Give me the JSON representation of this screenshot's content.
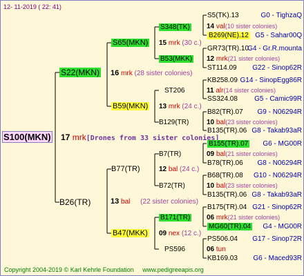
{
  "header": {
    "date": "12- 11-2019 ( 22: 41)"
  },
  "root": {
    "name": "S100(MKN)",
    "gen": "17",
    "unit": "mrk",
    "note": "[Drones from 33 sister colonies]"
  },
  "sire": {
    "name": "S22(MKN)",
    "gen": "16",
    "unit": "mrk",
    "note": "(28 sister colonies)"
  },
  "dam": {
    "name": "B26(TR)",
    "gen": "13",
    "unit": "bal",
    "note": "(22 sister colonies)"
  },
  "s_s": {
    "name": "S65(MKN)",
    "gen": "15",
    "unit": "mrk",
    "note": "(30 c.)"
  },
  "s_d": {
    "name": "B59(MKN)",
    "gen": "13",
    "unit": "mrk",
    "note": "(24 c.)"
  },
  "d_s": {
    "name": "B77(TR)",
    "gen": "12",
    "unit": "bal",
    "note": "(24 c.)"
  },
  "d_d": {
    "name": "B47(MKK)",
    "gen": "09",
    "unit": "nex",
    "note": "(12 c.)"
  },
  "g4": [
    {
      "name": "S348(TK)",
      "gen": "14",
      "unit": "val",
      "note": "(10 sister colonies)"
    },
    {
      "name": "B53(MKK)",
      "gen": "12",
      "unit": "mrk",
      "note": "(21 sister colonies)"
    },
    {
      "name": "ST206",
      "gen": "11",
      "unit": "alr",
      "note": "(14 sister colonies)"
    },
    {
      "name": "B129(TR)",
      "gen": "10",
      "unit": "bal",
      "note": "(23 sister colonies)"
    },
    {
      "name": "B7(TR)",
      "gen": "09",
      "unit": "bal",
      "note": "(21 sister colonies)"
    },
    {
      "name": "B72(TR)",
      "gen": "10",
      "unit": "bal",
      "note": "(23 sister colonies)"
    },
    {
      "name": "B171(TR)",
      "gen": "06",
      "unit": "mrk",
      "note": "(21 sister colonies)"
    },
    {
      "name": "PS596",
      "gen": "06",
      "unit": "tun",
      "note": ""
    }
  ],
  "leaves": [
    {
      "name": "S5(TK).13",
      "gen": "G0 - TighzaQ"
    },
    {
      "name": "B269(NE).12",
      "gen": "G5 - Sahar00Q"
    },
    {
      "name": "GR73(TR).10",
      "gen": "G4 - Gr.R.mounta"
    },
    {
      "name": "ST114.09",
      "gen": "G22 - Sinop62R"
    },
    {
      "name": "KB258.09",
      "gen": "G14 - SinopEgg86R"
    },
    {
      "name": "SS324.08",
      "gen": "G5 - Camic99R"
    },
    {
      "name": "B82(TR).07",
      "gen": "G9 - N06294R"
    },
    {
      "name": "B135(TR).06",
      "gen": "G8 - Takab93aR"
    },
    {
      "name": "B155(TR).07",
      "gen": "G6 - MG00R"
    },
    {
      "name": "B78(TR).06",
      "gen": "G8 - N06294R"
    },
    {
      "name": "B68(TR).08",
      "gen": "G10 - N06294R"
    },
    {
      "name": "B135(TR).06",
      "gen": "G8 - Takab93aR"
    },
    {
      "name": "B175(TR).04",
      "gen": "G21 - Sinop62R"
    },
    {
      "name": "MG60(TR).04",
      "gen": "G4 - MG00R"
    },
    {
      "name": "PS506.04",
      "gen": "G17 - Sinop72R"
    },
    {
      "name": "KB169.03",
      "gen": "G6 - Maced93R"
    }
  ],
  "footer": {
    "copyright": "Copyright 2004-2019 © Karl Kehrle Foundation",
    "url": "www.pedigreeapis.org"
  }
}
